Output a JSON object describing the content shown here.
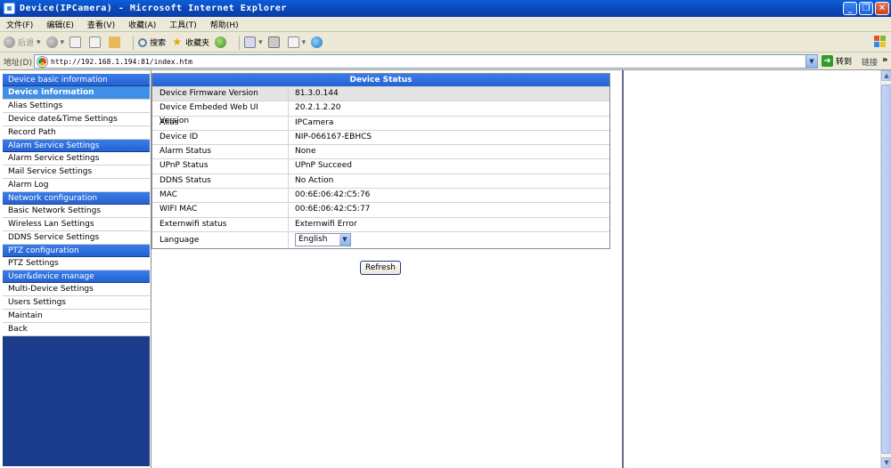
{
  "window": {
    "title": "Device(IPCamera) - Microsoft Internet Explorer",
    "controls": [
      "_",
      "❐",
      "✕"
    ]
  },
  "menubar": [
    "文件(F)",
    "编辑(E)",
    "查看(V)",
    "收藏(A)",
    "工具(T)",
    "帮助(H)"
  ],
  "toolbar": {
    "back": "后退",
    "search": "搜索",
    "favorites": "收藏夹"
  },
  "address": {
    "label": "地址(D)",
    "url": "http://192.168.1.194:81/index.htm",
    "go": "转到",
    "links": "链接"
  },
  "sidebar": {
    "sections": [
      {
        "header": "Device basic information",
        "items": [
          {
            "label": "Device information",
            "active": true
          },
          {
            "label": "Alias Settings"
          },
          {
            "label": "Device date&Time Settings"
          },
          {
            "label": "Record Path"
          }
        ]
      },
      {
        "header": "Alarm Service Settings",
        "items": [
          {
            "label": "Alarm Service Settings"
          },
          {
            "label": "Mail Service Settings"
          },
          {
            "label": "Alarm Log"
          }
        ]
      },
      {
        "header": "Network configuration",
        "items": [
          {
            "label": "Basic Network Settings"
          },
          {
            "label": "Wireless Lan Settings"
          },
          {
            "label": "DDNS Service Settings"
          }
        ]
      },
      {
        "header": "PTZ configuration",
        "items": [
          {
            "label": "PTZ Settings"
          }
        ]
      },
      {
        "header": "User&device manage",
        "items": [
          {
            "label": "Multi-Device Settings"
          },
          {
            "label": "Users Settings"
          },
          {
            "label": "Maintain"
          },
          {
            "label": "Back"
          }
        ]
      }
    ]
  },
  "status": {
    "title": "Device Status",
    "rows": [
      {
        "label": "Device Firmware Version",
        "value": "81.3.0.144"
      },
      {
        "label": "Device Embeded Web UI Version",
        "value": "20.2.1.2.20"
      },
      {
        "label": "Alias",
        "value": "IPCamera"
      },
      {
        "label": "Device ID",
        "value": "NIP-066167-EBHCS"
      },
      {
        "label": "Alarm Status",
        "value": "None"
      },
      {
        "label": "UPnP Status",
        "value": "UPnP Succeed"
      },
      {
        "label": "DDNS Status",
        "value": "No Action"
      },
      {
        "label": "MAC",
        "value": "00:6E:06:42:C5:76"
      },
      {
        "label": "WIFI MAC",
        "value": "00:6E:06:42:C5:77"
      },
      {
        "label": "Externwifi status",
        "value": "Externwifi Error"
      }
    ],
    "language_label": "Language",
    "language_value": "English",
    "refresh": "Refresh"
  }
}
